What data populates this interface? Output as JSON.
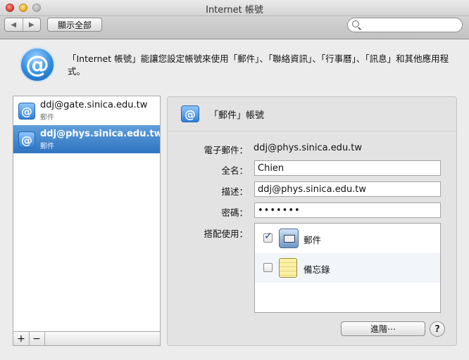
{
  "window": {
    "title": "Internet 帳號"
  },
  "toolbar": {
    "back_icon": "◀",
    "forward_icon": "▶",
    "show_all_label": "顯示全部",
    "search_value": ""
  },
  "header": {
    "icon_glyph": "@",
    "description": "「Internet 帳號」能讓您設定帳號來使用「郵件」、「聯絡資訊」、「行事曆」、「訊息」和其他應用程式。"
  },
  "accounts": [
    {
      "name": "ddj@gate.sinica.edu.tw",
      "kind": "郵件",
      "selected": false
    },
    {
      "name": "ddj@phys.sinica.edu.tw",
      "kind": "郵件",
      "selected": true
    }
  ],
  "list_footer": {
    "add": "+",
    "remove": "−"
  },
  "detail": {
    "title": "「郵件」帳號",
    "email_label": "電子郵件：",
    "email_value": "ddj@phys.sinica.edu.tw",
    "fullname_label": "全名：",
    "fullname_value": "Chien",
    "description_label": "描述：",
    "description_value": "ddj@phys.sinica.edu.tw",
    "password_label": "密碼：",
    "password_value": "•••••••",
    "use_with_label": "搭配使用：",
    "apps": [
      {
        "name": "郵件",
        "checked": true
      },
      {
        "name": "備忘錄",
        "checked": false
      }
    ],
    "advanced_label": "進階⋯",
    "help_label": "?"
  }
}
